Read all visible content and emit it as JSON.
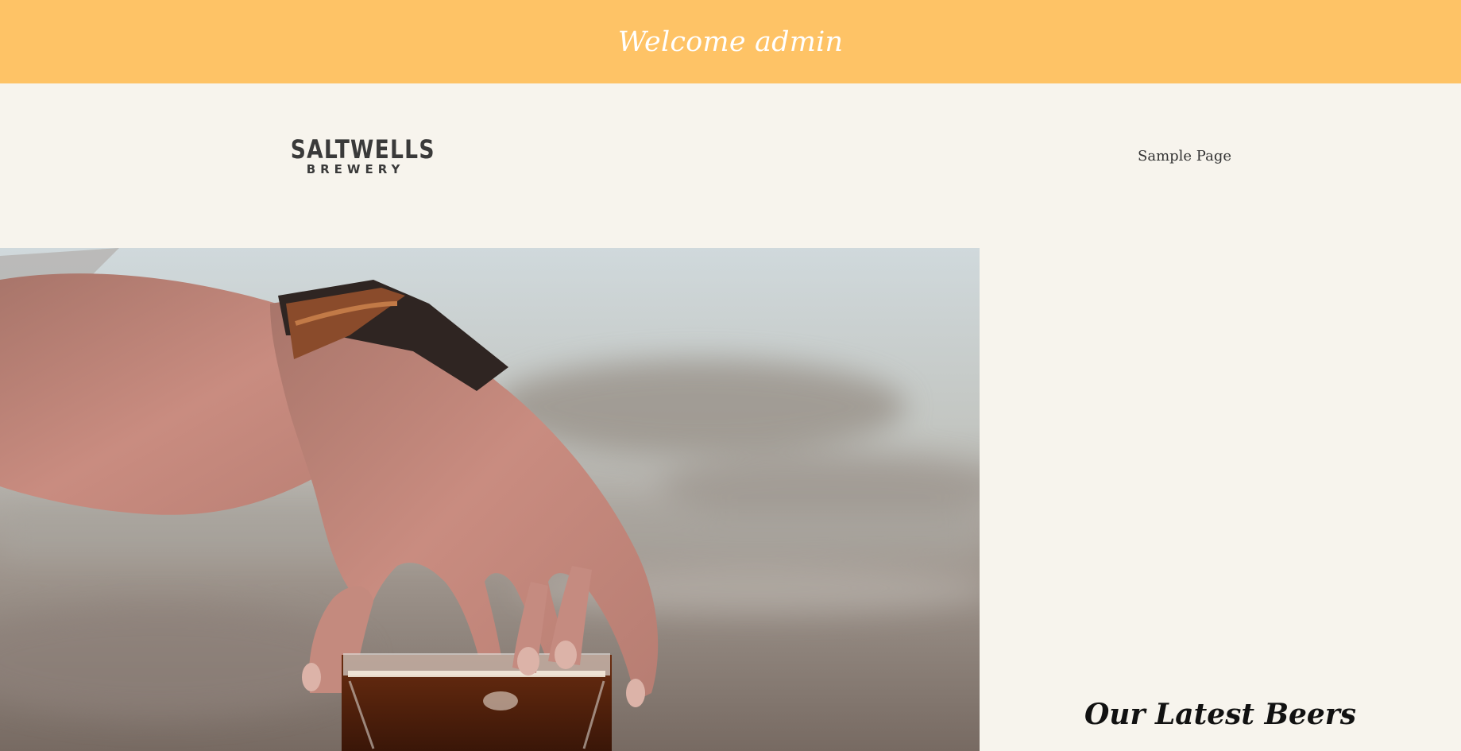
{
  "banner": {
    "welcome_text": "Welcome admin",
    "background_color": "#fec366"
  },
  "header": {
    "logo_line1": "SALTWELLS",
    "logo_line2": "BREWERY",
    "nav_items": [
      {
        "label": "Sample Page"
      }
    ]
  },
  "hero": {
    "subject": "hand-over-beer-glass-photo"
  },
  "sidebar": {
    "title": "Our Latest Beers"
  },
  "colors": {
    "page_background": "#f7f4ed",
    "banner_background": "#fec366",
    "text_dark": "#111111"
  }
}
